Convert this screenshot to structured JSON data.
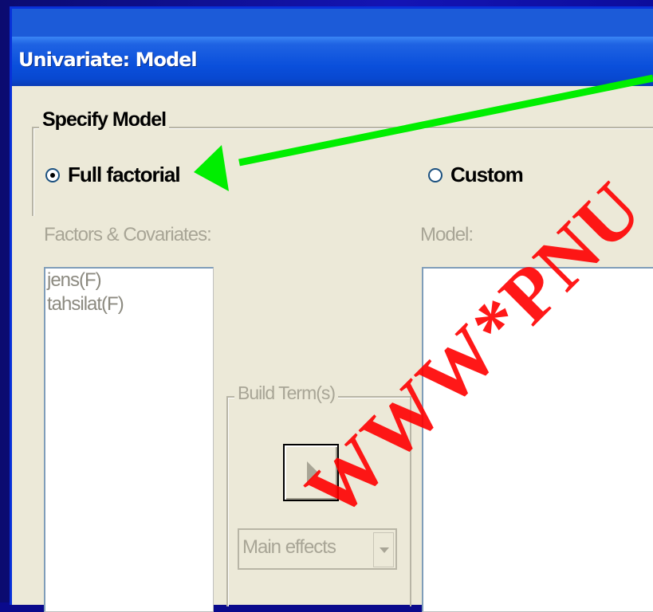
{
  "window": {
    "title": "Univariate: Model"
  },
  "specify_model": {
    "legend": "Specify Model",
    "full_factorial_label": "Full factorial",
    "custom_label": "Custom",
    "selected": "Full factorial"
  },
  "factors": {
    "label": "Factors & Covariates:",
    "items": [
      "jens(F)",
      "tahsilat(F)"
    ]
  },
  "model": {
    "label": "Model:"
  },
  "build_terms": {
    "legend": "Build Term(s)",
    "combo_value": "Main effects"
  },
  "annotation": {
    "arrow_color": "#00ee00"
  },
  "watermark": {
    "text": "WWW*PNU"
  },
  "colors": {
    "titlebar": "#0a4fdb",
    "dialog_bg": "#ece9d8",
    "watermark": "#ff0000"
  }
}
